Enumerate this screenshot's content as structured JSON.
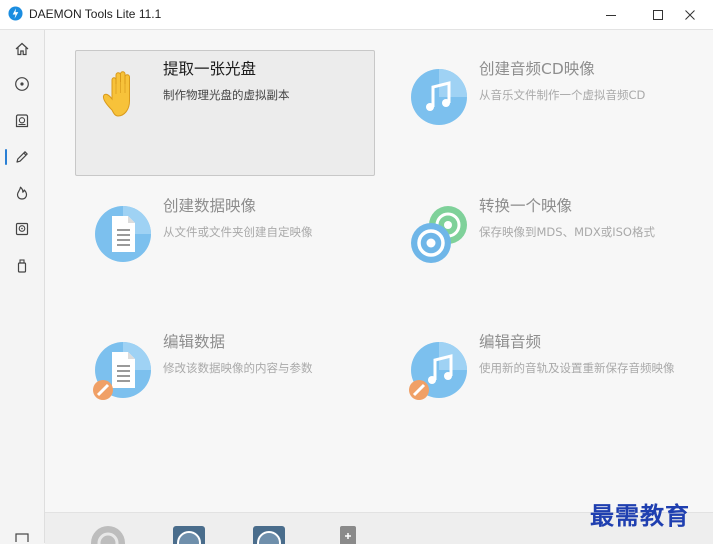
{
  "window": {
    "title": "DAEMON Tools Lite 11.1"
  },
  "tiles": [
    {
      "title": "提取一张光盘",
      "desc": "制作物理光盘的虚拟副本"
    },
    {
      "title": "创建音频CD映像",
      "desc": "从音乐文件制作一个虚拟音频CD"
    },
    {
      "title": "创建数据映像",
      "desc": "从文件或文件夹创建自定映像"
    },
    {
      "title": "转换一个映像",
      "desc": "保存映像到MDS、MDX或ISO格式"
    },
    {
      "title": "编辑数据",
      "desc": "修改该数据映像的内容与参数"
    },
    {
      "title": "编辑音频",
      "desc": "使用新的音轨及设置重新保存音频映像"
    }
  ],
  "watermark": "最需教育",
  "colors": {
    "accent": "#2a7fd4",
    "icon_blue": "#7cc0ee",
    "hand": "#f7c23a",
    "pencil": "#f0a066"
  }
}
